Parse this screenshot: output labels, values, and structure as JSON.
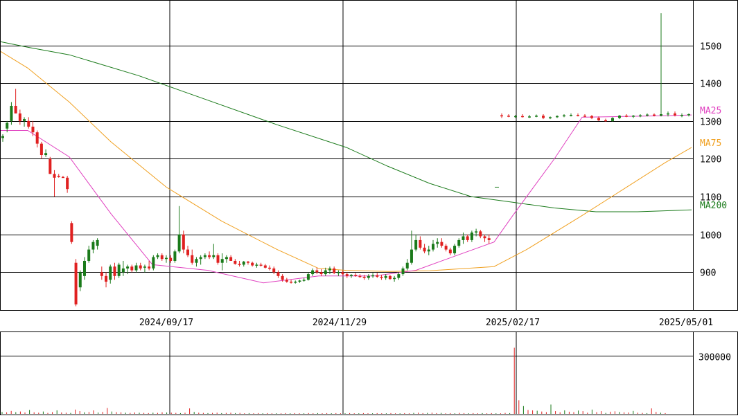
{
  "chart_data": {
    "type": "candlestick",
    "x_dates": [
      "2024/09/17",
      "2024/11/29",
      "2025/02/17",
      "2025/05/01"
    ],
    "price_axis": {
      "ticks": [
        "900",
        "1000",
        "1100",
        "1200",
        "1300",
        "1400",
        "1500"
      ],
      "ylim": [
        800,
        1620
      ]
    },
    "volume_axis": {
      "ticks": [
        "300000"
      ],
      "ylim": [
        0,
        420000
      ]
    },
    "legend": [
      {
        "label": "MA25",
        "color": "#e040c0"
      },
      {
        "label": "MA75",
        "color": "#f0a020"
      },
      {
        "label": "MA200",
        "color": "#1a7a1a"
      }
    ],
    "candles": [
      [
        1255,
        1265,
        1245,
        1260
      ],
      [
        1280,
        1300,
        1270,
        1295
      ],
      [
        1300,
        1350,
        1290,
        1340
      ],
      [
        1340,
        1385,
        1320,
        1320
      ],
      [
        1320,
        1330,
        1290,
        1300
      ],
      [
        1300,
        1310,
        1285,
        1305
      ],
      [
        1300,
        1310,
        1280,
        1285
      ],
      [
        1285,
        1300,
        1260,
        1270
      ],
      [
        1270,
        1275,
        1230,
        1240
      ],
      [
        1240,
        1245,
        1200,
        1210
      ],
      [
        1210,
        1225,
        1205,
        1215
      ],
      [
        1200,
        1205,
        1160,
        1160
      ],
      [
        1160,
        1170,
        1100,
        1150
      ],
      [
        1155,
        1160,
        1150,
        1152
      ],
      [
        1152,
        1155,
        1150,
        1150
      ],
      [
        1150,
        1155,
        1110,
        1120
      ],
      [
        1030,
        1035,
        975,
        980
      ],
      [
        925,
        935,
        810,
        815
      ],
      [
        860,
        905,
        850,
        900
      ],
      [
        890,
        940,
        880,
        930
      ],
      [
        930,
        970,
        925,
        960
      ],
      [
        960,
        985,
        950,
        980
      ],
      [
        970,
        990,
        960,
        985
      ],
      [
        900,
        915,
        880,
        890
      ],
      [
        890,
        900,
        860,
        875
      ],
      [
        880,
        920,
        870,
        915
      ],
      [
        915,
        925,
        880,
        890
      ],
      [
        890,
        925,
        885,
        920
      ],
      [
        900,
        930,
        890,
        910
      ],
      [
        910,
        920,
        895,
        915
      ],
      [
        915,
        920,
        900,
        905
      ],
      [
        905,
        925,
        900,
        918
      ],
      [
        918,
        925,
        905,
        910
      ],
      [
        912,
        920,
        900,
        915
      ],
      [
        915,
        930,
        905,
        910
      ],
      [
        910,
        945,
        905,
        940
      ],
      [
        940,
        950,
        935,
        945
      ],
      [
        945,
        950,
        930,
        935
      ],
      [
        935,
        945,
        925,
        938
      ],
      [
        938,
        945,
        925,
        930
      ],
      [
        930,
        960,
        925,
        955
      ],
      [
        955,
        1075,
        950,
        1000
      ],
      [
        1000,
        1010,
        950,
        960
      ],
      [
        960,
        970,
        940,
        945
      ],
      [
        945,
        960,
        920,
        925
      ],
      [
        925,
        940,
        915,
        935
      ],
      [
        935,
        945,
        920,
        940
      ],
      [
        940,
        950,
        935,
        945
      ],
      [
        945,
        955,
        935,
        940
      ],
      [
        940,
        975,
        935,
        945
      ],
      [
        945,
        950,
        920,
        925
      ],
      [
        925,
        950,
        905,
        935
      ],
      [
        935,
        945,
        925,
        940
      ],
      [
        940,
        945,
        930,
        930
      ],
      [
        930,
        935,
        920,
        922
      ],
      [
        922,
        930,
        915,
        920
      ],
      [
        920,
        930,
        915,
        928
      ],
      [
        928,
        930,
        920,
        925
      ],
      [
        925,
        928,
        915,
        918
      ],
      [
        918,
        925,
        912,
        920
      ],
      [
        920,
        925,
        915,
        918
      ],
      [
        918,
        922,
        910,
        912
      ],
      [
        912,
        918,
        905,
        910
      ],
      [
        910,
        915,
        895,
        900
      ],
      [
        900,
        905,
        885,
        890
      ],
      [
        890,
        895,
        875,
        880
      ],
      [
        880,
        885,
        872,
        875
      ],
      [
        875,
        880,
        870,
        873
      ],
      [
        873,
        878,
        870,
        875
      ],
      [
        875,
        880,
        872,
        878
      ],
      [
        878,
        885,
        875,
        880
      ],
      [
        880,
        900,
        878,
        895
      ],
      [
        895,
        910,
        890,
        905
      ],
      [
        905,
        912,
        895,
        900
      ],
      [
        900,
        908,
        890,
        895
      ],
      [
        895,
        912,
        890,
        905
      ],
      [
        905,
        915,
        895,
        910
      ],
      [
        910,
        915,
        895,
        898
      ],
      [
        898,
        905,
        890,
        900
      ],
      [
        900,
        905,
        892,
        895
      ],
      [
        895,
        900,
        885,
        890
      ],
      [
        890,
        895,
        885,
        893
      ],
      [
        893,
        898,
        888,
        890
      ],
      [
        890,
        895,
        885,
        888
      ],
      [
        888,
        893,
        880,
        885
      ],
      [
        885,
        895,
        880,
        890
      ],
      [
        890,
        898,
        885,
        892
      ],
      [
        892,
        898,
        885,
        888
      ],
      [
        888,
        893,
        880,
        885
      ],
      [
        885,
        895,
        880,
        890
      ],
      [
        890,
        893,
        880,
        882
      ],
      [
        882,
        890,
        875,
        885
      ],
      [
        885,
        900,
        880,
        895
      ],
      [
        895,
        915,
        890,
        910
      ],
      [
        910,
        935,
        905,
        925
      ],
      [
        925,
        1010,
        920,
        960
      ],
      [
        960,
        1000,
        955,
        985
      ],
      [
        985,
        995,
        960,
        965
      ],
      [
        965,
        975,
        950,
        955
      ],
      [
        955,
        970,
        945,
        960
      ],
      [
        960,
        985,
        955,
        975
      ],
      [
        975,
        990,
        965,
        980
      ],
      [
        980,
        990,
        965,
        970
      ],
      [
        970,
        975,
        955,
        960
      ],
      [
        960,
        965,
        945,
        950
      ],
      [
        950,
        975,
        945,
        970
      ],
      [
        970,
        990,
        965,
        985
      ],
      [
        985,
        1005,
        975,
        995
      ],
      [
        995,
        1000,
        980,
        985
      ],
      [
        985,
        1010,
        980,
        1005
      ],
      [
        1005,
        1015,
        995,
        1008
      ],
      [
        1008,
        1012,
        990,
        995
      ],
      [
        995,
        1000,
        980,
        990
      ],
      [
        990,
        1000,
        975,
        985
      ],
      [
        1315,
        1320,
        1308,
        1314
      ],
      [
        1314,
        1318,
        1310,
        1312
      ],
      [
        1312,
        1316,
        1308,
        1313
      ],
      [
        1313,
        1318,
        1309,
        1311
      ],
      [
        1311,
        1316,
        1308,
        1312
      ],
      [
        1312,
        1317,
        1310,
        1314
      ],
      [
        1314,
        1318,
        1305,
        1308
      ],
      [
        1308,
        1312,
        1305,
        1310
      ],
      [
        1310,
        1315,
        1308,
        1313
      ],
      [
        1313,
        1318,
        1310,
        1315
      ],
      [
        1315,
        1320,
        1312,
        1316
      ],
      [
        1316,
        1320,
        1312,
        1314
      ],
      [
        1314,
        1318,
        1310,
        1313
      ],
      [
        1313,
        1316,
        1305,
        1308
      ],
      [
        1308,
        1312,
        1300,
        1302
      ],
      [
        1302,
        1306,
        1298,
        1300
      ],
      [
        1300,
        1310,
        1298,
        1308
      ],
      [
        1308,
        1316,
        1305,
        1314
      ],
      [
        1314,
        1318,
        1310,
        1312
      ],
      [
        1312,
        1316,
        1308,
        1314
      ],
      [
        1314,
        1318,
        1310,
        1315
      ],
      [
        1315,
        1320,
        1312,
        1317
      ],
      [
        1317,
        1320,
        1312,
        1314
      ],
      [
        1314,
        1585,
        1312,
        1318
      ],
      [
        1318,
        1325,
        1312,
        1320
      ],
      [
        1320,
        1325,
        1312,
        1315
      ],
      [
        1315,
        1320,
        1310,
        1316
      ],
      [
        1316,
        1320,
        1312,
        1318
      ]
    ],
    "ma25": [
      [
        0,
        1275
      ],
      [
        40,
        1275
      ],
      [
        100,
        1205
      ],
      [
        160,
        1055
      ],
      [
        220,
        920
      ],
      [
        300,
        905
      ],
      [
        380,
        872
      ],
      [
        460,
        890
      ],
      [
        540,
        890
      ],
      [
        600,
        905
      ],
      [
        660,
        945
      ],
      [
        713,
        980
      ],
      [
        740,
        1050
      ],
      [
        800,
        1200
      ],
      [
        840,
        1310
      ],
      [
        900,
        1312
      ],
      [
        960,
        1314
      ],
      [
        998,
        1316
      ]
    ],
    "ma75": [
      [
        0,
        1485
      ],
      [
        40,
        1440
      ],
      [
        100,
        1350
      ],
      [
        160,
        1245
      ],
      [
        240,
        1125
      ],
      [
        320,
        1035
      ],
      [
        400,
        960
      ],
      [
        460,
        910
      ],
      [
        500,
        905
      ],
      [
        560,
        902
      ],
      [
        620,
        904
      ],
      [
        713,
        915
      ],
      [
        760,
        960
      ],
      [
        840,
        1050
      ],
      [
        900,
        1120
      ],
      [
        960,
        1190
      ],
      [
        998,
        1230
      ]
    ],
    "ma200": [
      [
        0,
        1510
      ],
      [
        40,
        1495
      ],
      [
        100,
        1475
      ],
      [
        200,
        1420
      ],
      [
        300,
        1355
      ],
      [
        400,
        1290
      ],
      [
        500,
        1230
      ],
      [
        560,
        1180
      ],
      [
        620,
        1135
      ],
      [
        680,
        1100
      ],
      [
        740,
        1085
      ],
      [
        800,
        1070
      ],
      [
        860,
        1060
      ],
      [
        920,
        1060
      ],
      [
        998,
        1065
      ]
    ],
    "volumes": [
      10000,
      8000,
      15000,
      9000,
      12000,
      7000,
      20000,
      8000,
      6000,
      12000,
      5000,
      9000,
      18000,
      7000,
      6000,
      5000,
      22000,
      14000,
      8000,
      10000,
      18000,
      7000,
      10000,
      30000,
      12000,
      9000,
      8000,
      6000,
      5000,
      7000,
      6000,
      5000,
      4000,
      6000,
      5000,
      8000,
      7000,
      6000,
      5000,
      4000,
      6000,
      28000,
      10000,
      6000,
      5000,
      4000,
      5000,
      6000,
      4000,
      5000,
      6000,
      4000,
      5000,
      3000,
      4000,
      3000,
      4000,
      3000,
      4000,
      3000,
      3000,
      3000,
      4000,
      3000,
      4000,
      3000,
      3000,
      4000,
      3000,
      4000,
      3000,
      4000,
      3000,
      4000,
      3000,
      3000,
      4000,
      3000,
      3000,
      4000,
      3000,
      3000,
      4000,
      3000,
      3000,
      4000,
      3000,
      3000,
      4000,
      3000,
      5000,
      6000,
      4000,
      5000,
      6000,
      4000,
      5000,
      3000,
      4000,
      3000,
      5000,
      4000,
      3000,
      4000,
      3000,
      4000,
      3000,
      4000,
      3000,
      3000,
      5000,
      4000,
      340000,
      70000,
      40000,
      20000,
      18000,
      16000,
      12000,
      9000,
      48000,
      14000,
      8000,
      18000,
      11000,
      9000,
      17000,
      14000,
      6000,
      22000,
      9000,
      14000,
      5000,
      11000,
      13000,
      10000,
      8000,
      7000,
      15000,
      6000,
      5000,
      4000,
      28000,
      10000,
      6000,
      4000
    ],
    "volume_colors_note": "up/down"
  },
  "colors": {
    "up": "#1a7a1a",
    "down": "#e02020",
    "grid": "#000000"
  }
}
